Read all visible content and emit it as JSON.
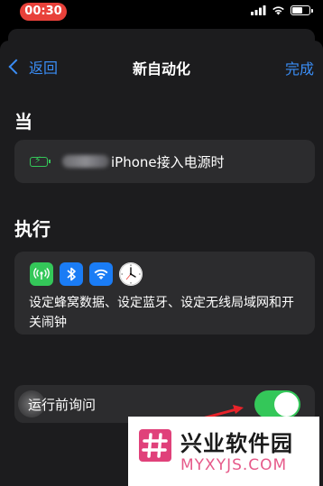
{
  "status_bar": {
    "time": "00:30",
    "icons": [
      "signal-icon",
      "wifi-icon",
      "battery-icon"
    ]
  },
  "nav": {
    "back_label": "返回",
    "title": "新自动化",
    "done_label": "完成"
  },
  "trigger_section": {
    "header": "当",
    "trigger_text": "iPhone接入电源时",
    "icon": "charging-battery-icon"
  },
  "action_section": {
    "header": "执行",
    "icons": [
      "cellular-data-icon",
      "bluetooth-icon",
      "wifi-icon",
      "clock-icon"
    ],
    "description": "设定蜂窝数据、设定蓝牙、设定无线局域网和开关闹钟"
  },
  "ask_before_running": {
    "label": "运行前询问",
    "enabled": true
  },
  "colors": {
    "accent_blue": "#3a8df5",
    "toggle_green": "#34c759",
    "card_bg": "#2c2c2e",
    "sheet_bg": "#1c1c1e",
    "time_pill": "#e8413a",
    "annotation_arrow": "#e8232a"
  },
  "watermark": {
    "title": "兴业软件园",
    "url": "MYXYJS.COM"
  }
}
